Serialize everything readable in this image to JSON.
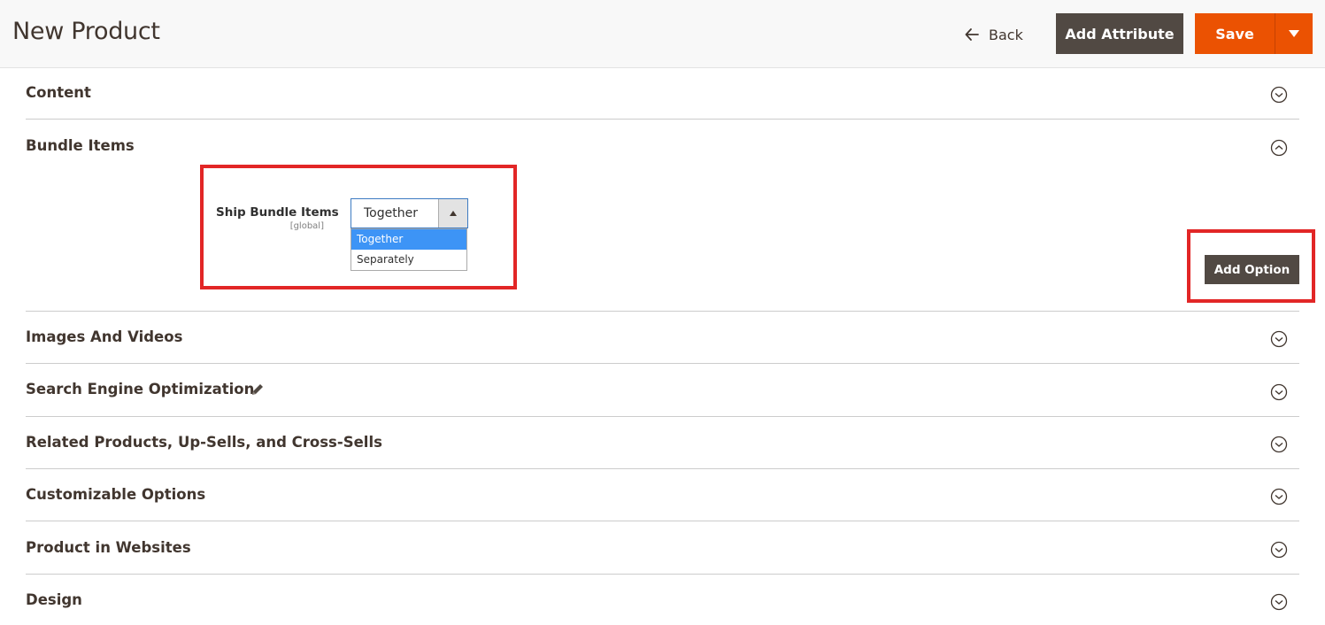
{
  "header": {
    "title": "New Product",
    "back_label": "Back",
    "add_attribute_label": "Add Attribute",
    "save_label": "Save"
  },
  "sections": {
    "content": "Content",
    "bundle_items": "Bundle Items",
    "images_videos": "Images And Videos",
    "seo": "Search Engine Optimization",
    "related": "Related Products, Up-Sells, and Cross-Sells",
    "customizable": "Customizable Options",
    "websites": "Product in Websites",
    "design": "Design"
  },
  "bundle": {
    "ship_label": "Ship Bundle Items",
    "scope": "[global]",
    "selected_value": "Together",
    "options": [
      "Together",
      "Separately"
    ],
    "add_option_label": "Add Option"
  },
  "colors": {
    "accent": "#eb5202",
    "dark_button": "#514943",
    "highlight": "#e22626",
    "select_highlight": "#3d94f6"
  },
  "icons": {
    "back": "arrow-left-icon",
    "save_toggle": "triangle-down-icon",
    "section_collapsed": "chevron-down-circle-icon",
    "section_expanded": "chevron-up-circle-icon",
    "seo_edit": "pencil-icon"
  }
}
